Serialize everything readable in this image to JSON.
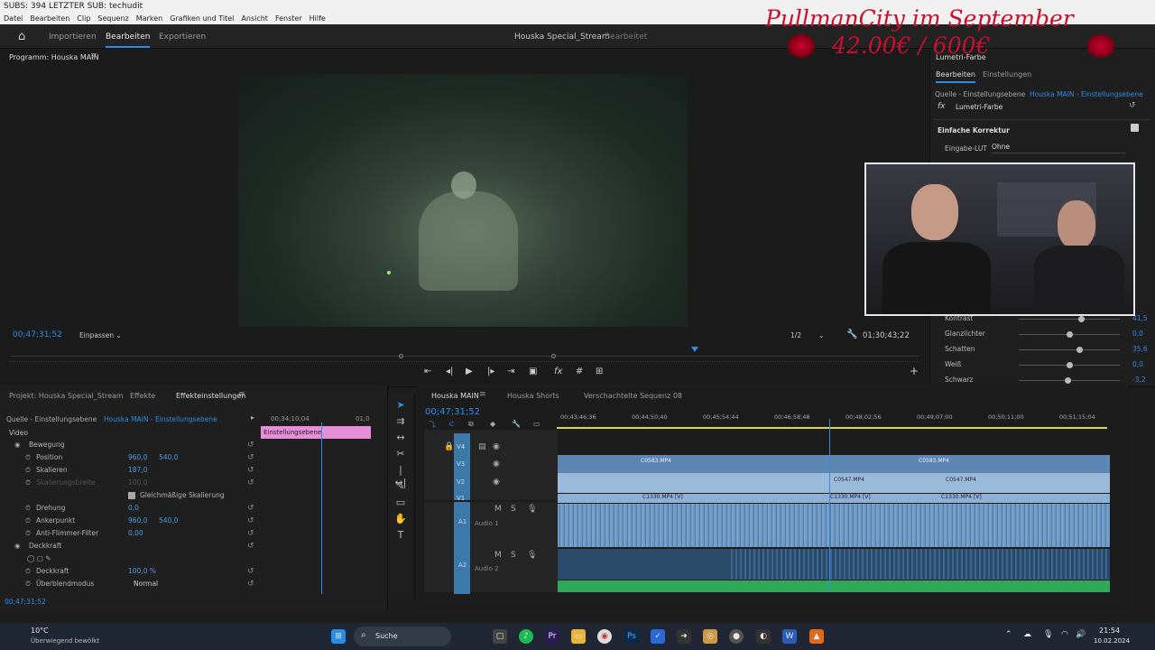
{
  "window": {
    "title": "SUBS: 394 LETZTER SUB: techudit",
    "menus": [
      "Datei",
      "Bearbeiten",
      "Clip",
      "Sequenz",
      "Marken",
      "Grafiken und Titel",
      "Ansicht",
      "Fenster",
      "Hilfe"
    ]
  },
  "workspace": {
    "tabs": [
      "Importieren",
      "Bearbeiten",
      "Exportieren"
    ],
    "project": "Houska Special_Stream",
    "state": "Bearbeitet"
  },
  "program": {
    "label": "Programm: Houska MAIN",
    "timecode": "00;47;31;52",
    "fit": "Einpassen",
    "resolution": "1/2",
    "duration": "01;30;43;22"
  },
  "overlay": {
    "title": "PullmanCity im September",
    "price": "42.00€ / 600€"
  },
  "lumetri": {
    "panel": "Lumetri-Farbe",
    "tabs": [
      "Bearbeiten",
      "Einstellungen"
    ],
    "source": "Quelle - Einstellungsebene",
    "target": "Houska MAIN - Einstellungsebene",
    "effect": "Lumetri-Farbe",
    "section": "Einfache Korrektur",
    "lut_label": "Eingabe-LUT",
    "lut_value": "Ohne",
    "sliders": [
      {
        "label": "Kontrast",
        "value": "41,5",
        "level": 0.62
      },
      {
        "label": "Glanzlichter",
        "value": "0,0",
        "level": 0.5
      },
      {
        "label": "Schatten",
        "value": "35,6",
        "level": 0.6
      },
      {
        "label": "Weiß",
        "value": "0,0",
        "level": 0.5
      },
      {
        "label": "Schwarz",
        "value": "-3,2",
        "level": 0.48
      }
    ]
  },
  "effects_panel": {
    "tabs": [
      "Projekt: Houska Special_Stream",
      "Effekte",
      "Effekteinstellungen"
    ],
    "source": "Quelle - Einstellungsebene",
    "target": "Houska MAIN - Einstellungsebene",
    "mini_time1": "00;34;10;04",
    "mini_time2": "01;0",
    "clip_name": "Einstellungsebene",
    "section_video": "Video",
    "timecode": "00;47;31;52",
    "rows": [
      {
        "label": "Bewegung"
      },
      {
        "label": "Position",
        "v1": "960,0",
        "v2": "540,0"
      },
      {
        "label": "Skalieren",
        "v1": "187,0"
      },
      {
        "label": "Skalierungsbreite",
        "v1": "100,0"
      },
      {
        "label": "Gleichmäßige Skalierung"
      },
      {
        "label": "Drehung",
        "v1": "0,0"
      },
      {
        "label": "Ankerpunkt",
        "v1": "960,0",
        "v2": "540,0"
      },
      {
        "label": "Anti-Flimmer-Filter",
        "v1": "0,00"
      },
      {
        "label": "Deckkraft"
      },
      {
        "label": ""
      },
      {
        "label": "Deckkraft",
        "v1": "100,0 %"
      },
      {
        "label": "Überblendmodus",
        "v1": "Normal"
      }
    ]
  },
  "timeline": {
    "tabs": [
      "Houska MAIN",
      "Houska Shorts",
      "Verschachtelte Sequenz 08"
    ],
    "timecode": "00;47;31;52",
    "ruler": [
      "00;43;46;36",
      "00;44;50;40",
      "00;45;54;44",
      "00;46;58;48",
      "00;48;02;56",
      "00;49;07;00",
      "00;50;11;00",
      "00;51;15;04"
    ],
    "tracks": [
      "V4",
      "V3",
      "V2",
      "V1",
      "A1",
      "A2"
    ],
    "track_names": {
      "a1": "Audio 1",
      "a2": "Audio 2"
    },
    "clip_labels": {
      "v3": "C0583.MP4",
      "v2": "C0547.MP4",
      "v1": "C1330.MP4 [V]"
    }
  },
  "taskbar": {
    "weather_temp": "10°C",
    "weather_desc": "Überwiegend bewölkt",
    "search": "Suche",
    "time": "21:54",
    "date": "10.02.2024"
  },
  "colors": {
    "accent": "#2d8ceb",
    "clip_pink": "#e48fd8",
    "audio_green": "#2fa85a",
    "overlay_red": "#c8102e"
  }
}
